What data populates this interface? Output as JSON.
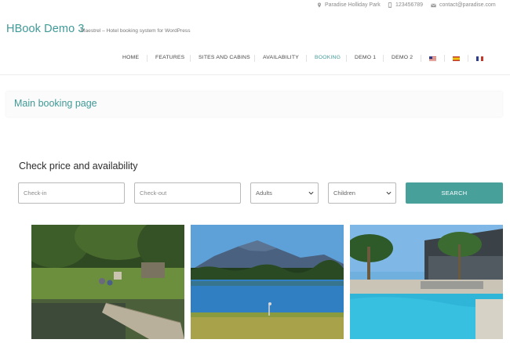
{
  "topbar": {
    "location": "Paradise Holliday Park",
    "phone": "123456789",
    "email": "contact@paradise.com"
  },
  "header": {
    "site_title": "HBook Demo 3",
    "tagline": "Maestrel – Hotel booking system for WordPress"
  },
  "nav": {
    "items": [
      "HOME",
      "FEATURES",
      "SITES AND CABINS",
      "AVAILABILITY",
      "BOOKING",
      "DEMO 1",
      "DEMO 2"
    ],
    "active": "BOOKING",
    "languages": [
      "en-flag-icon",
      "es-flag-icon",
      "fr-flag-icon"
    ]
  },
  "page": {
    "title": "Main booking page"
  },
  "booking_form": {
    "heading": "Check price and availability",
    "checkin_placeholder": "Check-in",
    "checkout_placeholder": "Check-out",
    "adults_label": "Adults",
    "children_label": "Children",
    "search_label": "SEARCH"
  },
  "gallery": [
    {
      "subject": "campsite-lake-photo"
    },
    {
      "subject": "mountain-lake-photo"
    },
    {
      "subject": "pool-palms-photo"
    }
  ],
  "colors": {
    "accent": "#3f9a97",
    "button": "#48a09b"
  }
}
